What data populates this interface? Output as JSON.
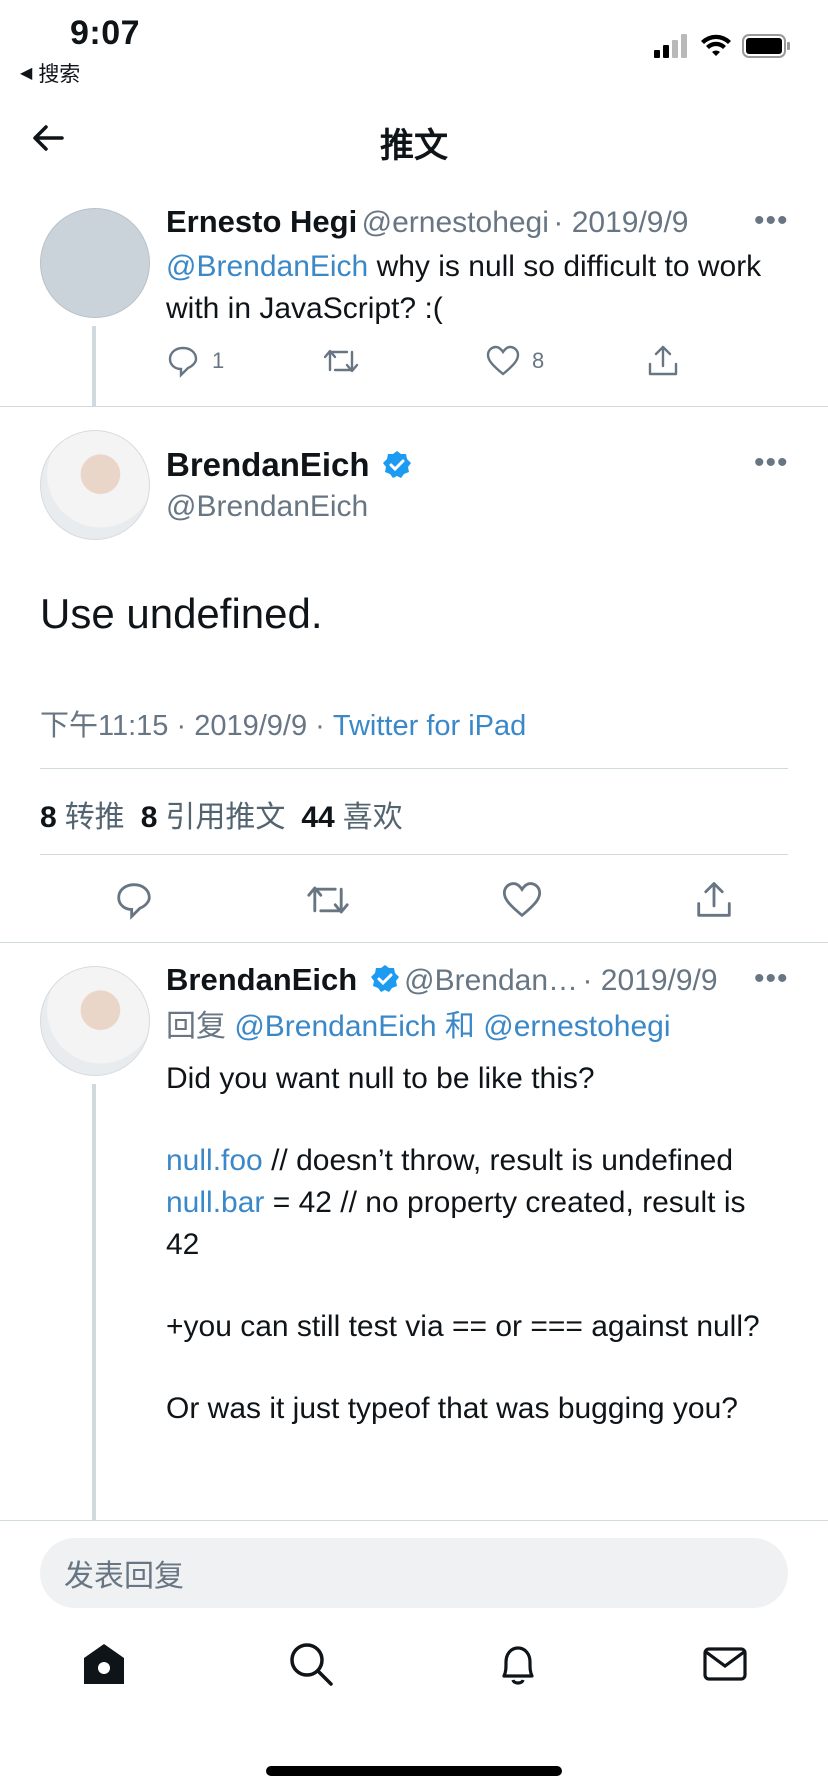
{
  "status_bar": {
    "time": "9:07",
    "back_app": "搜索"
  },
  "header": {
    "title": "推文"
  },
  "parent_tweet": {
    "name": "Ernesto Hegi",
    "handle": "@ernestohegi",
    "date": "· 2019/9/9",
    "mention": "@BrendanEich",
    "text": " why is null so difficult to work with in JavaScript? :(",
    "reply_count": "1",
    "like_count": "8"
  },
  "main_tweet": {
    "name": "BrendanEich",
    "handle": "@BrendanEich",
    "text": "Use undefined.",
    "time": "下午11:15 · 2019/9/9 · ",
    "source": "Twitter for iPad",
    "stats": {
      "retweets_num": "8",
      "retweets_label": "转推",
      "quotes_num": "8",
      "quotes_label": "引用推文",
      "likes_num": "44",
      "likes_label": "喜欢"
    }
  },
  "reply_tweet": {
    "name": "BrendanEich",
    "handle": "@Brendan…",
    "date": "· 2019/9/9",
    "reply_prefix": "回复 ",
    "reply_to": "@BrendanEich 和 @ernestohegi",
    "line1": "Did you want null to be like this?",
    "code1_link": "null.foo",
    "code1_rest": " // doesn’t throw, result is undefined",
    "code2_link": "null.bar",
    "code2_rest": " = 42 // no property created, result is 42",
    "line3": "+you can still test via == or === against null?",
    "line4": "Or was it just typeof that was bugging you?"
  },
  "composer": {
    "placeholder": "发表回复"
  },
  "colors": {
    "link": "#3b88c9",
    "muted": "#687684",
    "verified": "#1d9bf0"
  },
  "tabbar": {
    "icons": [
      "home-icon",
      "search-icon",
      "notifications-icon",
      "messages-icon"
    ]
  }
}
